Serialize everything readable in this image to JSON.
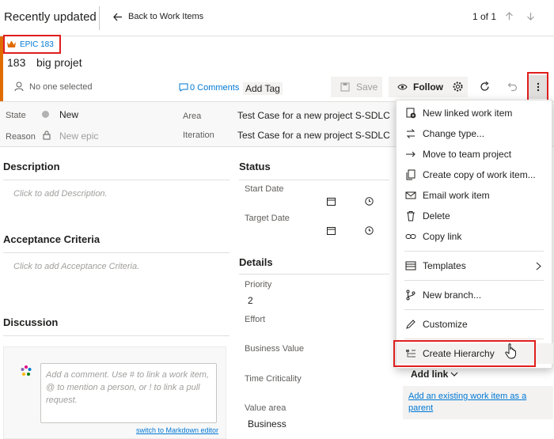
{
  "header": {
    "title": "Recently updated",
    "back_label": "Back to Work Items",
    "pager": "1 of 1"
  },
  "work_item": {
    "type_label": "EPIC 183",
    "id": "183",
    "title": "big projet",
    "assignee": "No one selected",
    "comments": "0 Comments",
    "add_tag": "Add Tag"
  },
  "toolbar": {
    "save_label": "Save",
    "follow_label": "Follow"
  },
  "fields": {
    "state_label": "State",
    "state_value": "New",
    "reason_label": "Reason",
    "reason_value": "New epic",
    "area_label": "Area",
    "area_value": "Test Case for a new project S-SDLC",
    "iteration_label": "Iteration",
    "iteration_value": "Test Case for a new project S-SDLC"
  },
  "sections": {
    "description_title": "Description",
    "description_placeholder": "Click to add Description.",
    "acceptance_title": "Acceptance Criteria",
    "acceptance_placeholder": "Click to add Acceptance Criteria.",
    "discussion_title": "Discussion",
    "comment_placeholder": "Add a comment. Use # to link a work item, @ to mention a person, or ! to link a pull request.",
    "markdown_link": "switch to Markdown editor"
  },
  "status": {
    "title": "Status",
    "start_date_label": "Start Date",
    "target_date_label": "Target Date"
  },
  "details": {
    "title": "Details",
    "priority_label": "Priority",
    "priority_value": "2",
    "effort_label": "Effort",
    "business_value_label": "Business Value",
    "time_criticality_label": "Time Criticality",
    "value_area_label": "Value area",
    "value_area_value": "Business"
  },
  "related": {
    "add_link": "Add link",
    "add_existing": "Add an existing work item as a parent"
  },
  "menu": {
    "items": [
      {
        "label": "New linked work item",
        "icon": "new-linked-icon"
      },
      {
        "label": "Change type...",
        "icon": "change-type-icon"
      },
      {
        "label": "Move to team project",
        "icon": "move-icon"
      },
      {
        "label": "Create copy of work item...",
        "icon": "copy-item-icon"
      },
      {
        "label": "Email work item",
        "icon": "email-icon"
      },
      {
        "label": "Delete",
        "icon": "trash-icon"
      },
      {
        "label": "Copy link",
        "icon": "link-icon"
      },
      {
        "label": "Templates",
        "icon": "templates-icon"
      },
      {
        "label": "New branch...",
        "icon": "branch-icon"
      },
      {
        "label": "Customize",
        "icon": "pencil-icon"
      },
      {
        "label": "Create Hierarchy",
        "icon": "hierarchy-icon"
      }
    ]
  },
  "colors": {
    "epic_orange": "#e06c00",
    "accent_blue": "#0078d4",
    "highlight_red": "#e01e1e"
  }
}
